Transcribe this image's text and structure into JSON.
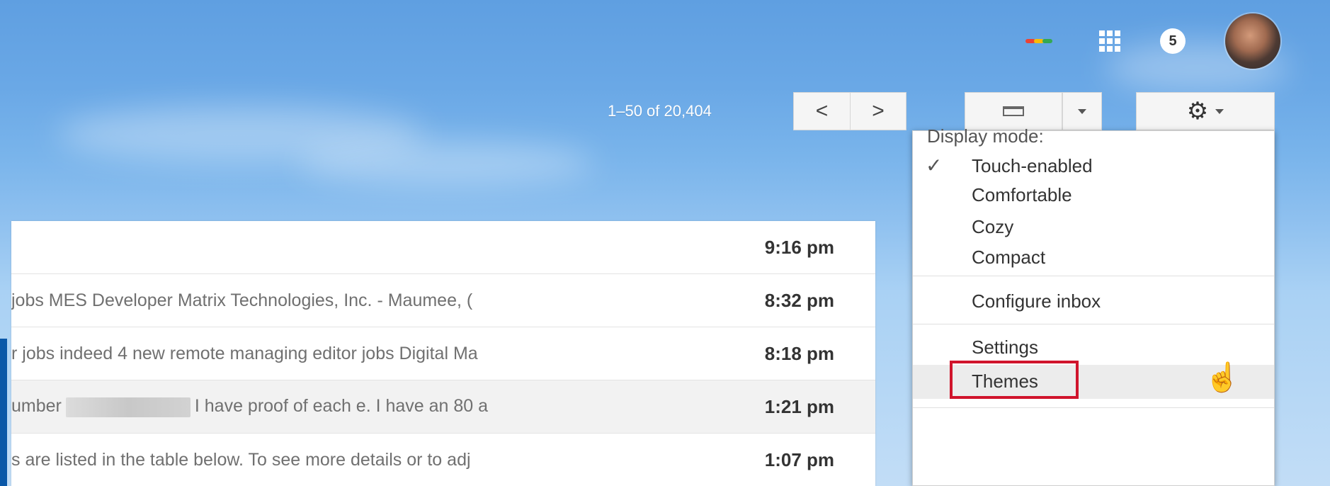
{
  "header": {
    "notification_count": "5"
  },
  "toolbar": {
    "range_text": "1–50 of 20,404",
    "prev_label": "<",
    "next_label": ">"
  },
  "mail_rows": [
    {
      "snippet": "",
      "time": "9:16 pm"
    },
    {
      "snippet": "jobs MES Developer Matrix Technologies, Inc. - Maumee, (",
      "time": "8:32 pm"
    },
    {
      "snippet": "r jobs indeed 4 new remote managing editor jobs Digital Ma",
      "time": "8:18 pm"
    },
    {
      "snippet_prefix": "umber",
      "snippet_suffix": "I have proof of each e. I have an 80 a",
      "time": "1:21 pm"
    },
    {
      "snippet": "s are listed in the table below. To see more details or to adj",
      "time": "1:07 pm"
    }
  ],
  "settings_menu": {
    "heading": "Display mode:",
    "checkmark": "✓",
    "items": [
      "Touch-enabled",
      "Comfortable",
      "Cozy",
      "Compact"
    ],
    "configure": "Configure inbox",
    "settings": "Settings",
    "themes": "Themes"
  },
  "colors": {
    "highlight_border": "#d0142c",
    "header_blue": "#5f9fe1"
  }
}
